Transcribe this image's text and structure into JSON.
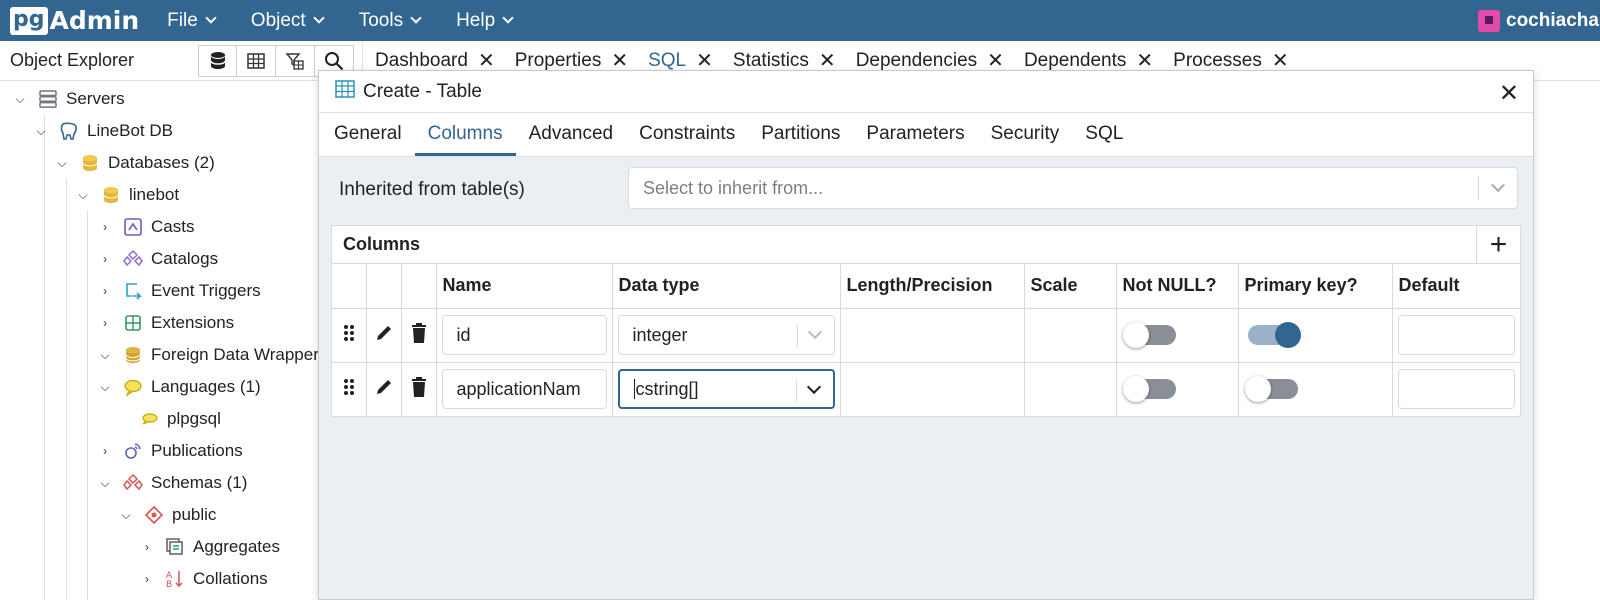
{
  "app": {
    "logo_pg": "pg",
    "logo_admin": "Admin"
  },
  "menu": [
    "File",
    "Object",
    "Tools",
    "Help"
  ],
  "user": {
    "name": "cochiachan"
  },
  "object_explorer": {
    "title": "Object Explorer",
    "tree": [
      {
        "label": "Servers",
        "icon": "servers-icon",
        "toggle": "expanded"
      },
      {
        "label": "LineBot DB",
        "icon": "elephant-icon",
        "toggle": "expanded"
      },
      {
        "label": "Databases (2)",
        "icon": "databases-icon",
        "toggle": "expanded"
      },
      {
        "label": "linebot",
        "icon": "database-icon",
        "toggle": "expanded"
      },
      {
        "label": "Casts",
        "icon": "casts-icon",
        "toggle": "collapsed"
      },
      {
        "label": "Catalogs",
        "icon": "catalogs-icon",
        "toggle": "collapsed"
      },
      {
        "label": "Event Triggers",
        "icon": "event-triggers-icon",
        "toggle": "collapsed"
      },
      {
        "label": "Extensions",
        "icon": "extensions-icon",
        "toggle": "collapsed"
      },
      {
        "label": "Foreign Data Wrappers",
        "icon": "foreign-data-wrappers-icon",
        "toggle": "expanded"
      },
      {
        "label": "Languages (1)",
        "icon": "languages-icon",
        "toggle": "expanded"
      },
      {
        "label": "plpgsql",
        "icon": "language-icon",
        "toggle": "none"
      },
      {
        "label": "Publications",
        "icon": "publications-icon",
        "toggle": "collapsed"
      },
      {
        "label": "Schemas (1)",
        "icon": "schemas-icon",
        "toggle": "expanded"
      },
      {
        "label": "public",
        "icon": "schema-icon",
        "toggle": "expanded"
      },
      {
        "label": "Aggregates",
        "icon": "aggregates-icon",
        "toggle": "collapsed"
      },
      {
        "label": "Collations",
        "icon": "collations-icon",
        "toggle": "collapsed"
      }
    ]
  },
  "tabs": [
    "Dashboard",
    "Properties",
    "SQL",
    "Statistics",
    "Dependencies",
    "Dependents",
    "Processes"
  ],
  "active_tab": "SQL",
  "dialog": {
    "title": "Create - Table",
    "tabs": [
      "General",
      "Columns",
      "Advanced",
      "Constraints",
      "Partitions",
      "Parameters",
      "Security",
      "SQL"
    ],
    "active_tab": "Columns",
    "inherit_label": "Inherited from table(s)",
    "inherit_placeholder": "Select to inherit from...",
    "columns_section_title": "Columns",
    "columns_headers": [
      "Name",
      "Data type",
      "Length/Precision",
      "Scale",
      "Not NULL?",
      "Primary key?",
      "Default"
    ],
    "rows": [
      {
        "name": "id",
        "data_type": "integer",
        "length": "",
        "scale": "",
        "not_null": false,
        "primary_key": true,
        "default": ""
      },
      {
        "name": "applicationNam",
        "data_type": "cstring[]",
        "length": "",
        "scale": "",
        "not_null": false,
        "primary_key": false,
        "default": ""
      }
    ]
  },
  "colors": {
    "header_bg": "#326690",
    "accent": "#326690",
    "body_bg": "#ebeef3"
  }
}
